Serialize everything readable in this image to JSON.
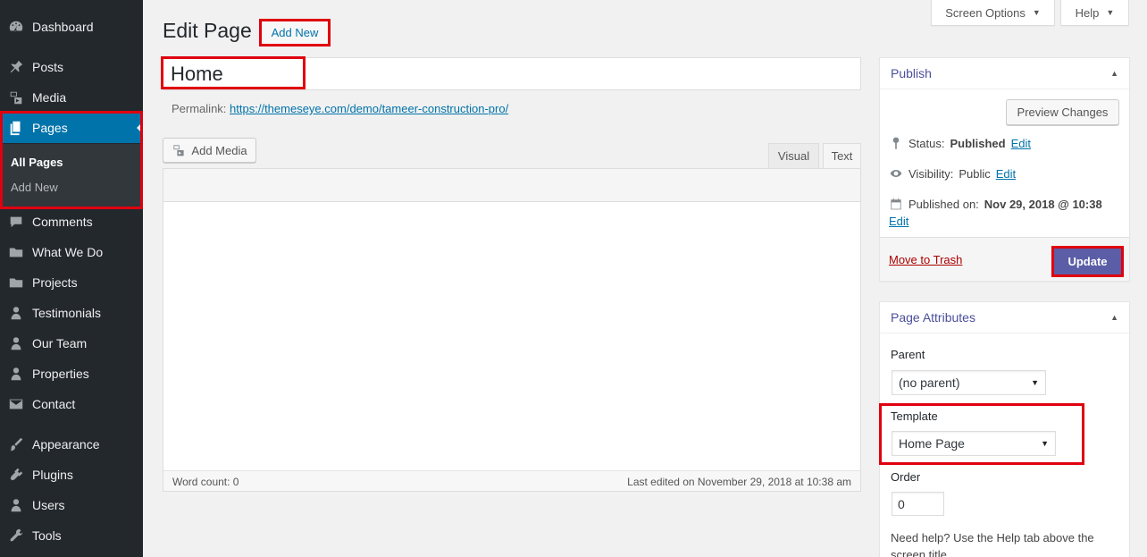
{
  "sidebar": {
    "items": [
      {
        "label": "Dashboard",
        "icon": "dashboard-icon"
      },
      {
        "label": "Posts",
        "icon": "pin-icon"
      },
      {
        "label": "Media",
        "icon": "media-icon"
      },
      {
        "label": "Pages",
        "icon": "pages-icon"
      },
      {
        "label": "Comments",
        "icon": "comment-icon"
      },
      {
        "label": "What We Do",
        "icon": "folder-icon"
      },
      {
        "label": "Projects",
        "icon": "folder-icon"
      },
      {
        "label": "Testimonials",
        "icon": "person-icon"
      },
      {
        "label": "Our Team",
        "icon": "person-icon"
      },
      {
        "label": "Properties",
        "icon": "person-icon"
      },
      {
        "label": "Contact",
        "icon": "email-icon"
      },
      {
        "label": "Appearance",
        "icon": "brush-icon"
      },
      {
        "label": "Plugins",
        "icon": "plugin-icon"
      },
      {
        "label": "Users",
        "icon": "users-icon"
      },
      {
        "label": "Tools",
        "icon": "wrench-icon"
      }
    ],
    "submenu": {
      "current": "All Pages",
      "other": "Add New"
    }
  },
  "top": {
    "screen_options": "Screen Options",
    "help": "Help"
  },
  "header": {
    "title": "Edit Page",
    "add_new": "Add New"
  },
  "post": {
    "title": "Home",
    "permalink_label": "Permalink:",
    "permalink_url": "https://themeseye.com/demo/tameer-construction-pro/"
  },
  "editor": {
    "add_media": "Add Media",
    "tab_visual": "Visual",
    "tab_text": "Text",
    "word_count": "Word count: 0",
    "last_edited": "Last edited on November 29, 2018 at 10:38 am"
  },
  "publish": {
    "title": "Publish",
    "preview": "Preview Changes",
    "status_label": "Status:",
    "status_value": "Published",
    "visibility_label": "Visibility:",
    "visibility_value": "Public",
    "published_label": "Published on:",
    "published_value": "Nov 29, 2018 @ 10:38",
    "edit": "Edit",
    "trash": "Move to Trash",
    "update": "Update"
  },
  "attributes": {
    "title": "Page Attributes",
    "parent_label": "Parent",
    "parent_value": "(no parent)",
    "template_label": "Template",
    "template_value": "Home Page",
    "order_label": "Order",
    "order_value": "0",
    "help": "Need help? Use the Help tab above the screen title."
  },
  "colors": {
    "highlight": "#e0000f",
    "accent": "#0073aa",
    "sidebar": "#23282d",
    "update_button": "#5b5ea6"
  }
}
